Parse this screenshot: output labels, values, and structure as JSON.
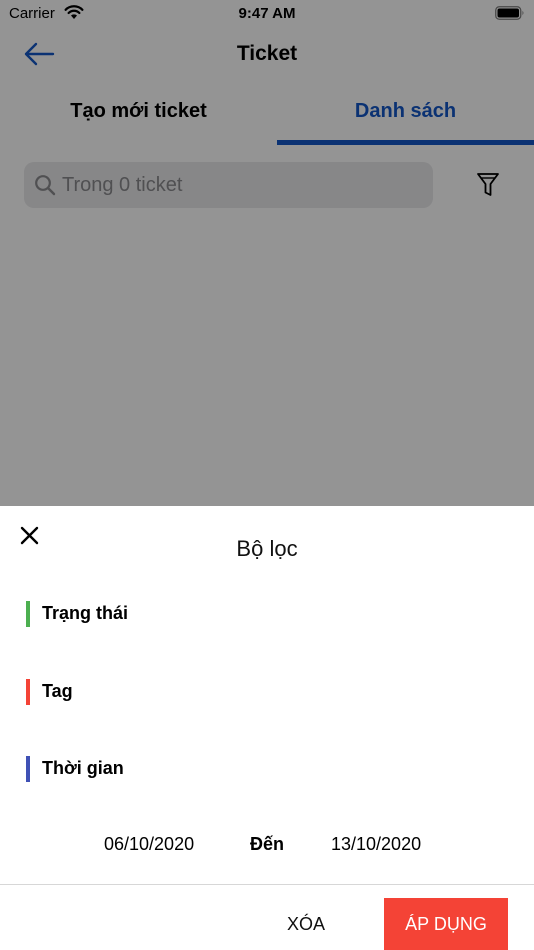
{
  "status_bar": {
    "carrier": "Carrier",
    "time": "9:47 AM"
  },
  "nav": {
    "title": "Ticket",
    "back_icon": "arrow-left-icon"
  },
  "tabs": [
    {
      "label": "Tạo mới ticket",
      "active": false
    },
    {
      "label": "Danh sách",
      "active": true
    }
  ],
  "search": {
    "placeholder": "Trong 0 ticket",
    "value": ""
  },
  "filter_sheet": {
    "title": "Bộ lọc",
    "sections": [
      {
        "label": "Trạng thái",
        "color": "#4caf50"
      },
      {
        "label": "Tag",
        "color": "#f44336"
      },
      {
        "label": "Thời gian",
        "color": "#3f51b5"
      }
    ],
    "date_from": "06/10/2020",
    "date_separator": "Đến",
    "date_to": "13/10/2020",
    "clear_label": "XÓA",
    "apply_label": "ÁP DỤNG"
  },
  "colors": {
    "accent": "#1457c6",
    "apply": "#f44336"
  }
}
